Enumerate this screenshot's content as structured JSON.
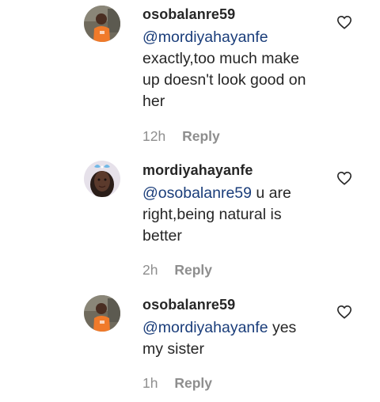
{
  "comments": [
    {
      "username": "osobalanre59",
      "mention": "@mordiyahayanfe",
      "text_after": "",
      "text_lines": [
        "exactly,too much make",
        "up doesn't look good on",
        "her"
      ],
      "time": "12h",
      "reply_label": "Reply",
      "avatar": "avatar-boy-orange-shirt"
    },
    {
      "username": "mordiyahayanfe",
      "mention": "@osobalanre59",
      "text_after": " u are",
      "text_lines": [
        "right,being natural is",
        "better"
      ],
      "time": "2h",
      "reply_label": "Reply",
      "avatar": "avatar-girl-butterfly"
    },
    {
      "username": "osobalanre59",
      "mention": "@mordiyahayanfe",
      "text_after": " yes",
      "text_lines": [
        "my sister"
      ],
      "time": "1h",
      "reply_label": "Reply",
      "avatar": "avatar-boy-orange-shirt"
    }
  ],
  "icons": {
    "like": "heart-outline-icon"
  },
  "colors": {
    "mention": "#1a3d7a",
    "meta": "#8e8e8e",
    "text": "#262626"
  }
}
